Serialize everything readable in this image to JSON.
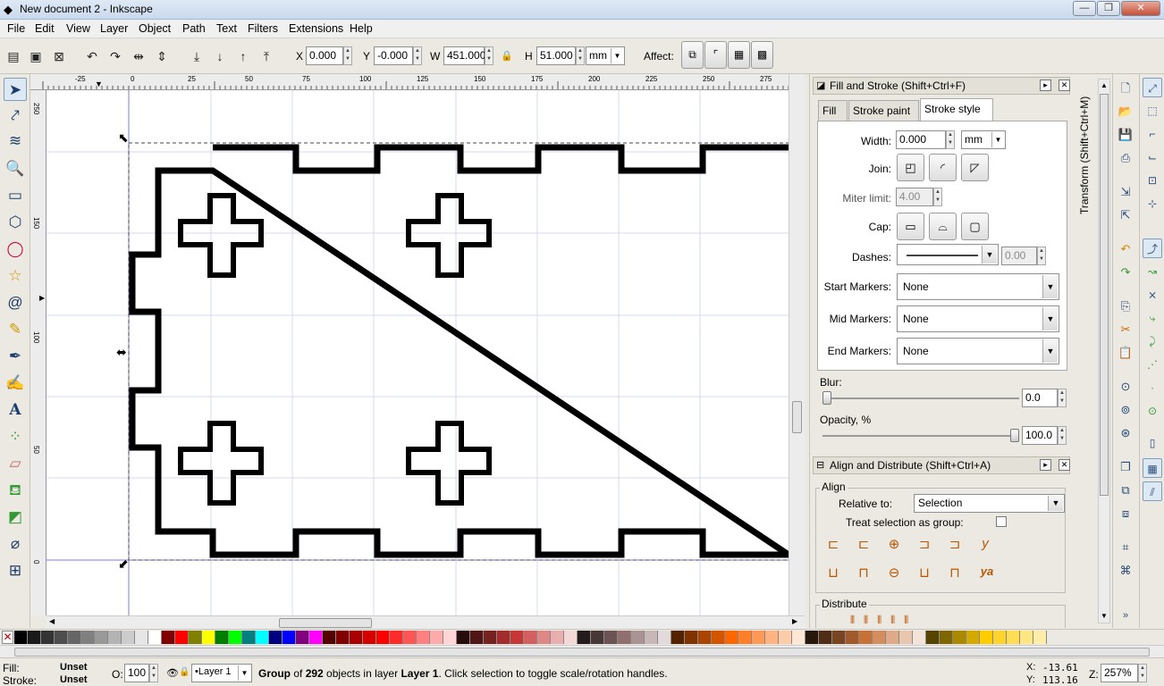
{
  "window": {
    "title": "New document 2 - Inkscape",
    "min": "—",
    "max": "❐",
    "close": "✕"
  },
  "menu": [
    "File",
    "Edit",
    "View",
    "Layer",
    "Object",
    "Path",
    "Text",
    "Filters",
    "Extensions",
    "Help"
  ],
  "toolctl": {
    "x_label": "X",
    "x_value": "0.000",
    "y_label": "Y",
    "y_value": "-0.000",
    "w_label": "W",
    "w_value": "451.000",
    "h_label": "H",
    "h_value": "51.000",
    "unit": "mm",
    "affect_label": "Affect:"
  },
  "rulers": {
    "h_ticks": [
      "-25",
      "0",
      "25",
      "50",
      "75",
      "100",
      "125",
      "150",
      "175",
      "200",
      "225",
      "250",
      "275"
    ],
    "v_ticks": [
      "250",
      "150",
      "100",
      "50",
      "0"
    ]
  },
  "fill_stroke": {
    "title": "Fill and Stroke (Shift+Ctrl+F)",
    "tabs": [
      "Fill",
      "Stroke paint",
      "Stroke style"
    ],
    "width_label": "Width:",
    "width_value": "0.000",
    "width_unit": "mm",
    "join_label": "Join:",
    "miter_label": "Miter limit:",
    "miter_value": "4.00",
    "cap_label": "Cap:",
    "dashes_label": "Dashes:",
    "dashes_value": "0.00",
    "start_markers_label": "Start Markers:",
    "start_markers_value": "None",
    "mid_markers_label": "Mid Markers:",
    "mid_markers_value": "None",
    "end_markers_label": "End Markers:",
    "end_markers_value": "None",
    "blur_label": "Blur:",
    "blur_value": "0.0",
    "opacity_label": "Opacity, %",
    "opacity_value": "100.0",
    "blur_fraction": 0.0,
    "opacity_fraction": 1.0
  },
  "align": {
    "title": "Align and Distribute (Shift+Ctrl+A)",
    "align_section": "Align",
    "relative_label": "Relative to:",
    "relative_value": "Selection",
    "treat_group_label": "Treat selection as group:",
    "distribute_section": "Distribute"
  },
  "transform_tab": "Transform (Shift+Ctrl+M)",
  "palette_colors": [
    "#000000",
    "#1a1a1a",
    "#333333",
    "#4d4d4d",
    "#666666",
    "#808080",
    "#999999",
    "#b3b3b3",
    "#cccccc",
    "#e6e6e6",
    "#ffffff",
    "#800000",
    "#ff0000",
    "#808000",
    "#ffff00",
    "#008000",
    "#00ff00",
    "#008080",
    "#00ffff",
    "#000080",
    "#0000ff",
    "#800080",
    "#ff00ff",
    "#550000",
    "#800000",
    "#aa0000",
    "#d40000",
    "#ff0000",
    "#ff2a2a",
    "#ff5555",
    "#ff8080",
    "#ffaaaa",
    "#ffd5d5",
    "#280b0b",
    "#501616",
    "#782121",
    "#a02c2c",
    "#c83737",
    "#d35f5f",
    "#de8787",
    "#e9afaf",
    "#f4d7d7",
    "#241c1c",
    "#483737",
    "#6c5353",
    "#916f6f",
    "#ac9393",
    "#c8b7b7",
    "#e3dbdb",
    "#552200",
    "#803300",
    "#aa4400",
    "#d45500",
    "#ff6600",
    "#ff7f2a",
    "#ff9955",
    "#ffb380",
    "#ffccaa",
    "#ffe6d5",
    "#28170b",
    "#502d16",
    "#784421",
    "#a05a2c",
    "#c87137",
    "#d38d5f",
    "#deaa87",
    "#e9c6af",
    "#f4e3d7",
    "#554400",
    "#806600",
    "#aa8800",
    "#d4aa00",
    "#ffcc00",
    "#ffd42a",
    "#ffdd55",
    "#ffe680",
    "#ffeeaa"
  ],
  "status": {
    "fill_label": "Fill:",
    "fill_value": "Unset",
    "stroke_label": "Stroke:",
    "stroke_value": "Unset",
    "o_label": "O:",
    "o_value": "100",
    "layer": "•Layer 1",
    "message_bold": "Group",
    "message_mid": " of ",
    "message_count": "292",
    "message_mid2": " objects in layer ",
    "message_layer": "Layer 1",
    "message_end": ". Click selection to toggle scale/rotation handles.",
    "x_label": "X:",
    "x_value": "-13.61",
    "y_label": "Y:",
    "y_value": "113.16",
    "z_label": "Z:",
    "zoom": "257%"
  }
}
